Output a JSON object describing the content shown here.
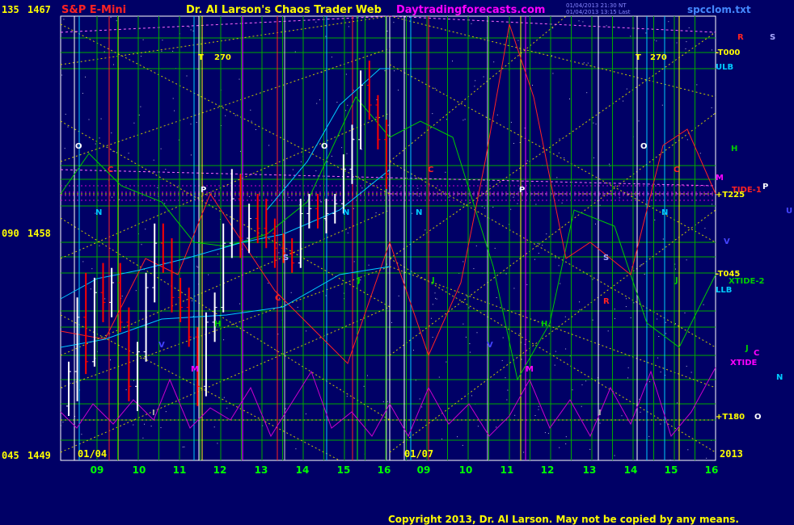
{
  "header": {
    "instrument": "S&P E-Mini",
    "site_name": "Dr. Al Larson's Chaos Trader Web",
    "url_text": "Daytradingforecasts.com",
    "file_name": "spcclom.txt",
    "timestamp_1": "01/04/2013 21:30 NT",
    "timestamp_2": "01/04/2013 13:15 Last",
    "copyright": "Copyright 2013, Dr. Al Larson. May not be copied by any means."
  },
  "colors": {
    "background": "#000066",
    "instrument": "#ff2222",
    "site_name": "#ffff00",
    "url": "#ff00ff",
    "file": "#4488ff",
    "copyright": "#ffff00",
    "bars_up": "#ffffff",
    "bars_down": "#ff0000",
    "grid_h": "#00aa00",
    "grid_diag": "#cccc00"
  },
  "chart_data": {
    "type": "bar",
    "y_axis": {
      "ticks": [
        {
          "angle": "135",
          "price": "1467",
          "value": 1467
        },
        {
          "angle": "090",
          "price": "1458",
          "value": 1458
        },
        {
          "angle": "045",
          "price": "1449",
          "value": 1449
        }
      ],
      "ylim": [
        1449,
        1467
      ]
    },
    "date_labels": [
      "01/04",
      "01/07"
    ],
    "year_label": "2013",
    "hour_ticks": [
      "09",
      "10",
      "11",
      "12",
      "13",
      "14",
      "15",
      "16",
      "09",
      "10",
      "11",
      "12",
      "13",
      "14",
      "15",
      "16"
    ],
    "price_series": [
      {
        "t": 0,
        "o": 1451.2,
        "h": 1453.0,
        "l": 1450.8,
        "c": 1452.6
      },
      {
        "t": 1,
        "o": 1452.6,
        "h": 1455.6,
        "l": 1451.4,
        "c": 1454.8
      },
      {
        "t": 2,
        "o": 1454.8,
        "h": 1456.6,
        "l": 1452.5,
        "c": 1453.0
      },
      {
        "t": 3,
        "o": 1453.0,
        "h": 1456.4,
        "l": 1452.8,
        "c": 1455.8
      },
      {
        "t": 4,
        "o": 1455.8,
        "h": 1457.0,
        "l": 1454.6,
        "c": 1455.4
      },
      {
        "t": 5,
        "o": 1455.4,
        "h": 1456.8,
        "l": 1454.8,
        "c": 1456.2
      },
      {
        "t": 6,
        "o": 1456.2,
        "h": 1457.0,
        "l": 1454.2,
        "c": 1454.6
      },
      {
        "t": 7,
        "o": 1454.6,
        "h": 1455.2,
        "l": 1451.4,
        "c": 1452.0
      },
      {
        "t": 8,
        "o": 1452.0,
        "h": 1453.8,
        "l": 1451.0,
        "c": 1453.4
      },
      {
        "t": 9,
        "o": 1453.4,
        "h": 1456.6,
        "l": 1453.0,
        "c": 1456.0
      },
      {
        "t": 10,
        "o": 1456.0,
        "h": 1458.6,
        "l": 1455.4,
        "c": 1457.8
      },
      {
        "t": 11,
        "o": 1457.8,
        "h": 1458.6,
        "l": 1456.6,
        "c": 1457.0
      },
      {
        "t": 12,
        "o": 1457.0,
        "h": 1458.0,
        "l": 1455.0,
        "c": 1455.6
      },
      {
        "t": 13,
        "o": 1455.6,
        "h": 1456.4,
        "l": 1454.6,
        "c": 1455.2
      },
      {
        "t": 14,
        "o": 1455.2,
        "h": 1456.0,
        "l": 1453.6,
        "c": 1454.0
      },
      {
        "t": 15,
        "o": 1454.0,
        "h": 1454.4,
        "l": 1451.2,
        "c": 1452.0
      },
      {
        "t": 16,
        "o": 1452.0,
        "h": 1455.0,
        "l": 1451.6,
        "c": 1454.6
      },
      {
        "t": 17,
        "o": 1454.6,
        "h": 1455.8,
        "l": 1453.8,
        "c": 1455.2
      },
      {
        "t": 18,
        "o": 1455.2,
        "h": 1458.6,
        "l": 1455.0,
        "c": 1457.8
      },
      {
        "t": 19,
        "o": 1457.8,
        "h": 1460.8,
        "l": 1457.2,
        "c": 1459.6
      },
      {
        "t": 20,
        "o": 1459.6,
        "h": 1460.6,
        "l": 1457.2,
        "c": 1458.0
      },
      {
        "t": 21,
        "o": 1458.0,
        "h": 1459.4,
        "l": 1457.4,
        "c": 1458.8
      },
      {
        "t": 22,
        "o": 1458.8,
        "h": 1459.8,
        "l": 1457.8,
        "c": 1458.4
      },
      {
        "t": 23,
        "o": 1458.4,
        "h": 1459.6,
        "l": 1457.6,
        "c": 1458.2
      },
      {
        "t": 24,
        "o": 1458.2,
        "h": 1458.8,
        "l": 1456.8,
        "c": 1457.6
      },
      {
        "t": 25,
        "o": 1457.6,
        "h": 1458.2,
        "l": 1457.0,
        "c": 1457.4
      },
      {
        "t": 26,
        "o": 1457.4,
        "h": 1458.0,
        "l": 1456.6,
        "c": 1457.0
      },
      {
        "t": 27,
        "o": 1457.0,
        "h": 1459.6,
        "l": 1456.8,
        "c": 1459.0
      },
      {
        "t": 28,
        "o": 1459.0,
        "h": 1459.8,
        "l": 1458.4,
        "c": 1459.2
      },
      {
        "t": 29,
        "o": 1459.2,
        "h": 1459.8,
        "l": 1458.4,
        "c": 1458.8
      },
      {
        "t": 30,
        "o": 1458.8,
        "h": 1459.6,
        "l": 1458.2,
        "c": 1459.0
      },
      {
        "t": 31,
        "o": 1459.0,
        "h": 1459.8,
        "l": 1458.6,
        "c": 1459.4
      },
      {
        "t": 32,
        "o": 1459.4,
        "h": 1461.4,
        "l": 1459.0,
        "c": 1460.8
      },
      {
        "t": 33,
        "o": 1460.8,
        "h": 1462.6,
        "l": 1460.2,
        "c": 1462.0
      },
      {
        "t": 34,
        "o": 1462.0,
        "h": 1464.8,
        "l": 1461.6,
        "c": 1464.2
      },
      {
        "t": 35,
        "o": 1464.2,
        "h": 1465.2,
        "l": 1462.8,
        "c": 1463.4
      },
      {
        "t": 36,
        "o": 1463.4,
        "h": 1463.8,
        "l": 1461.6,
        "c": 1462.0
      },
      {
        "t": 37,
        "o": 1462.0,
        "h": 1462.8,
        "l": 1460.0,
        "c": 1460.6
      }
    ],
    "series": [],
    "flux_labels": [
      {
        "text": "T",
        "color": "#ffff00"
      },
      {
        "text": "270",
        "color": "#ffff00"
      },
      {
        "text": "T",
        "color": "#ffff00"
      },
      {
        "text": "270",
        "color": "#ffff00"
      },
      {
        "text": "O",
        "color": "#ffffff"
      },
      {
        "text": "O",
        "color": "#ffffff"
      },
      {
        "text": "O",
        "color": "#ffffff"
      },
      {
        "text": "C",
        "color": "#ff2222"
      },
      {
        "text": "C",
        "color": "#ff2222"
      },
      {
        "text": "C",
        "color": "#ff2222"
      },
      {
        "text": "C",
        "color": "#ff2222"
      },
      {
        "text": "P",
        "color": "#ffffff"
      },
      {
        "text": "P",
        "color": "#ffffff"
      },
      {
        "text": "N",
        "color": "#00ccff"
      },
      {
        "text": "N",
        "color": "#00ccff"
      },
      {
        "text": "N",
        "color": "#00ccff"
      },
      {
        "text": "N",
        "color": "#00ccff"
      },
      {
        "text": "S",
        "color": "#aaaaff"
      },
      {
        "text": "S",
        "color": "#aaaaff"
      },
      {
        "text": "J",
        "color": "#00cc00"
      },
      {
        "text": "J",
        "color": "#00cc00"
      },
      {
        "text": "J",
        "color": "#00cc00"
      },
      {
        "text": "H",
        "color": "#00cc00"
      },
      {
        "text": "H",
        "color": "#00cc00"
      },
      {
        "text": "R",
        "color": "#ff2222"
      },
      {
        "text": "V",
        "color": "#4444ff"
      },
      {
        "text": "V",
        "color": "#4444ff"
      },
      {
        "text": "M",
        "color": "#ff00ff"
      },
      {
        "text": "M",
        "color": "#ff00ff"
      },
      {
        "text": "I",
        "color": "#aaaaaa"
      },
      {
        "text": "I",
        "color": "#aaaaaa"
      }
    ],
    "right_labels": [
      {
        "text": "R",
        "color": "#ff2222"
      },
      {
        "text": "S",
        "color": "#aaaaff"
      },
      {
        "text": "-T000",
        "color": "#ffff00"
      },
      {
        "text": "ULB",
        "color": "#00ccff"
      },
      {
        "text": "H",
        "color": "#00cc00"
      },
      {
        "text": "M",
        "color": "#ff00ff"
      },
      {
        "text": "TIDE-1",
        "color": "#ff2222"
      },
      {
        "text": "P",
        "color": "#ffffff"
      },
      {
        "text": "+T225",
        "color": "#ffff00"
      },
      {
        "text": "U",
        "color": "#4444ff"
      },
      {
        "text": "V",
        "color": "#4444ff"
      },
      {
        "text": "-T045",
        "color": "#ffff00"
      },
      {
        "text": "XTIDE-2",
        "color": "#00cc00"
      },
      {
        "text": "LLB",
        "color": "#00ccff"
      },
      {
        "text": "J",
        "color": "#00cc00"
      },
      {
        "text": "C",
        "color": "#ff00ff"
      },
      {
        "text": "XTIDE",
        "color": "#ff00ff"
      },
      {
        "text": "N",
        "color": "#00ccff"
      },
      {
        "text": "+T180",
        "color": "#ffff00"
      },
      {
        "text": "O",
        "color": "#ffffff"
      }
    ]
  }
}
